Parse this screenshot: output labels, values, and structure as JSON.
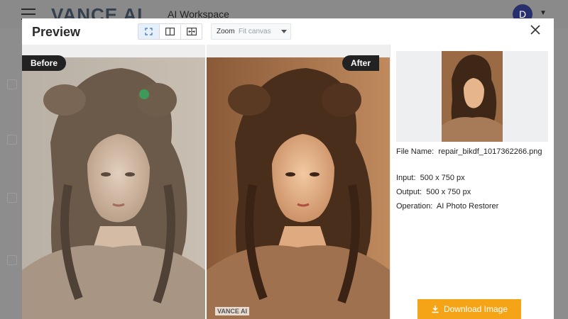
{
  "app": {
    "brand": "VANCE AI",
    "workspace": "AI Workspace",
    "avatar_initial": "D"
  },
  "modal": {
    "title": "Preview",
    "view_modes": [
      "fit-icon",
      "split-icon",
      "slider-icon"
    ],
    "zoom": {
      "label": "Zoom",
      "value": "Fit canvas"
    },
    "compare": {
      "before_label": "Before",
      "after_label": "After",
      "watermark": "VANCE AI"
    },
    "info": {
      "file_name_label": "File Name:",
      "file_name": "repair_bikdf_1017362266.png",
      "input_label": "Input:",
      "input": "500 x 750 px",
      "output_label": "Output:",
      "output": "500 x 750 px",
      "operation_label": "Operation:",
      "operation": "AI Photo Restorer"
    },
    "download_label": "Download Image"
  },
  "colors": {
    "accent": "#f6a417",
    "dim_overlay": "#8d8d8d",
    "tag_bg": "#222222"
  }
}
